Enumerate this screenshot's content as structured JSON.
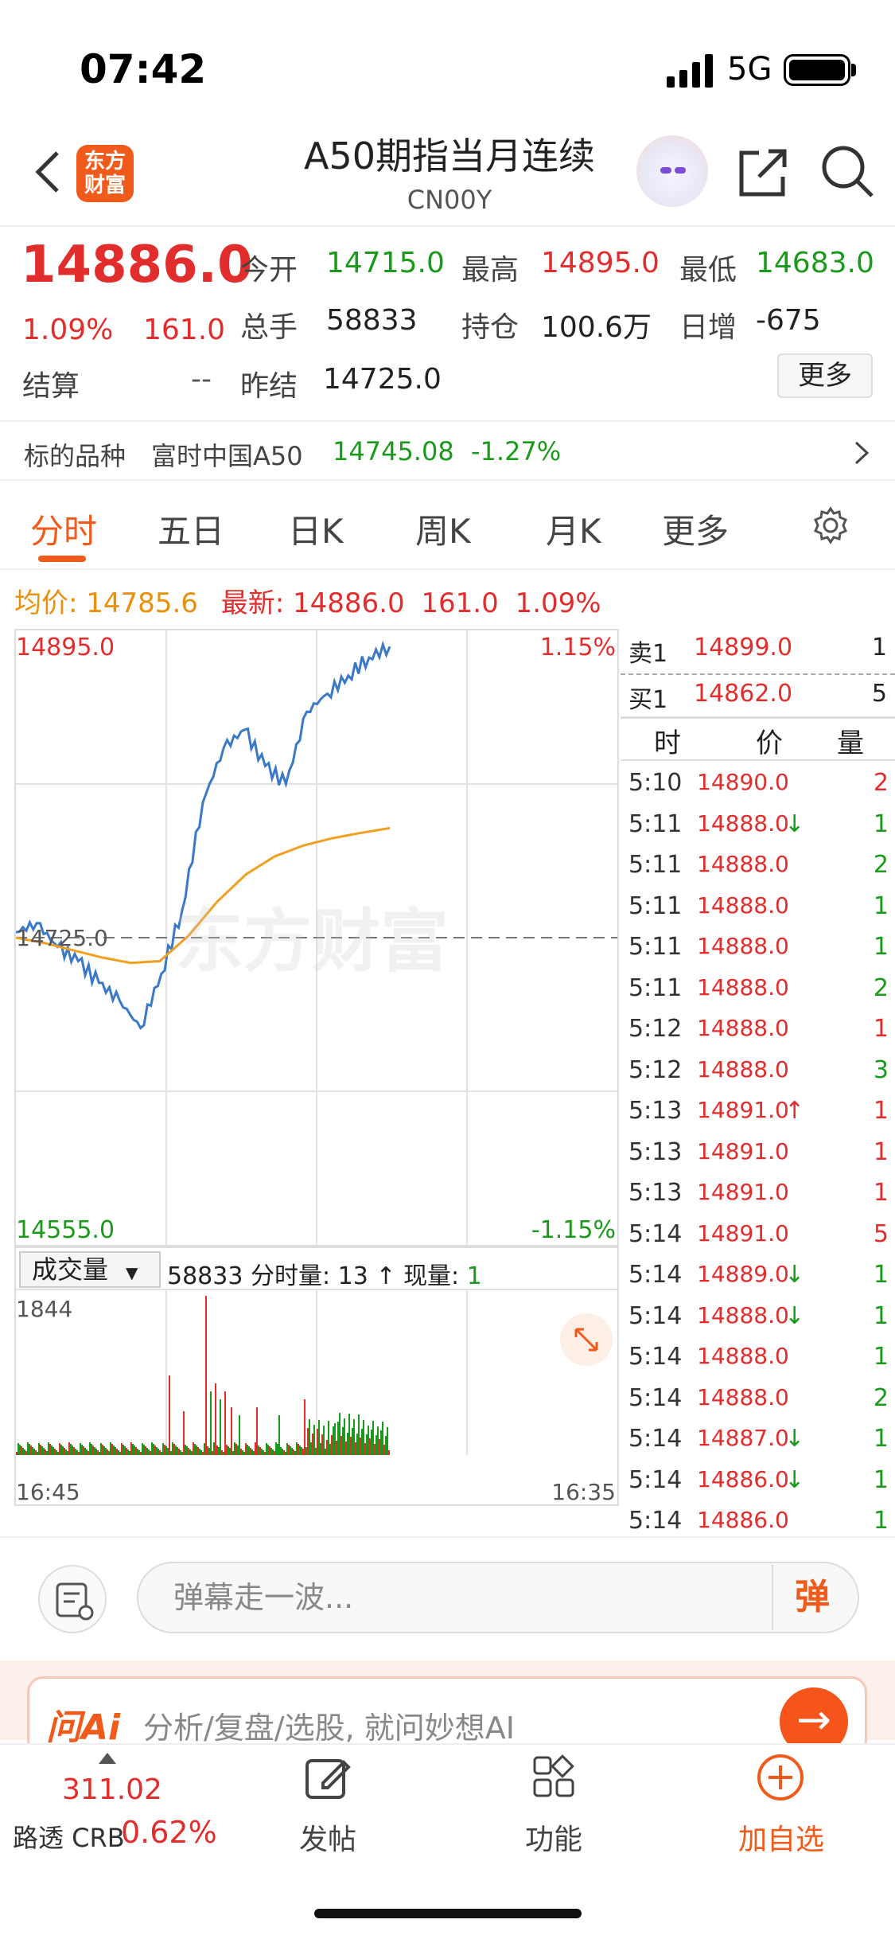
{
  "status": {
    "time": "07:42",
    "network": "5G"
  },
  "header": {
    "title": "A50期指当月连续",
    "code": "CN00Y",
    "logo": "东方财富"
  },
  "quote": {
    "last": "14886.0",
    "pct": "1.09%",
    "chg": "161.0",
    "rows": [
      [
        {
          "k": "今开",
          "v": "14715.0",
          "c": "green"
        },
        {
          "k": "最高",
          "v": "14895.0",
          "c": "red"
        },
        {
          "k": "最低",
          "v": "14683.0",
          "c": "green"
        }
      ],
      [
        {
          "k": "总手",
          "v": "58833",
          "c": "black"
        },
        {
          "k": "持仓",
          "v": "100.6万",
          "c": "black"
        },
        {
          "k": "日增",
          "v": "-675",
          "c": "black"
        }
      ]
    ],
    "settle_label": "结算",
    "settle": "--",
    "prev_label": "昨结",
    "prev": "14725.0",
    "more": "更多"
  },
  "underlying": {
    "label": "标的品种",
    "name": "富时中国A50",
    "value": "14745.08",
    "pct": "-1.27%"
  },
  "tabs": [
    "分时",
    "五日",
    "日K",
    "周K",
    "月K",
    "更多"
  ],
  "avgline": {
    "avg_label": "均价:",
    "avg": "14785.6",
    "last_label": "最新:",
    "last": "14886.0",
    "chg": "161.0",
    "pct": "1.09%"
  },
  "chart": {
    "ymax": "14895.0",
    "ymin": "14555.0",
    "mid": "14725.0",
    "pmax": "1.15%",
    "pmin": "-1.15%",
    "xstart": "16:45",
    "xend": "16:35",
    "watermark": "东方财富",
    "price_color": "#3a78c8",
    "avg_color": "#f0a020"
  },
  "volume": {
    "select": "成交量",
    "total": "58833",
    "fs_label": "分时量:",
    "fs": "13",
    "up": "↑",
    "now_label": "现量:",
    "now": "1",
    "max": "1844"
  },
  "chart_data": {
    "type": "line",
    "x": [
      "16:45",
      "16:35"
    ],
    "ylim": [
      14555.0,
      14895.0
    ],
    "prev_settle": 14725.0,
    "series": [
      {
        "values": [
          14728,
          14733,
          14720,
          14712,
          14700,
          14690,
          14675,
          14705,
          14740,
          14800,
          14830,
          14840,
          14820,
          14810,
          14850,
          14860,
          14870,
          14880,
          14886
        ]
      },
      {
        "values": [
          14725,
          14722,
          14718,
          14714,
          14711,
          14712,
          14726,
          14745,
          14760,
          14770,
          14776,
          14780,
          14783,
          14785.6
        ]
      }
    ]
  },
  "orderbook": {
    "sell": {
      "label": "卖1",
      "price": "14899.0",
      "qty": "1"
    },
    "buy": {
      "label": "买1",
      "price": "14862.0",
      "qty": "5"
    },
    "cols": [
      "时",
      "价",
      "量"
    ],
    "ticks": [
      [
        "5:10",
        "14890.0",
        "",
        "2",
        "red"
      ],
      [
        "5:11",
        "14888.0",
        "↓",
        "1",
        "green"
      ],
      [
        "5:11",
        "14888.0",
        "",
        "2",
        "green"
      ],
      [
        "5:11",
        "14888.0",
        "",
        "1",
        "green"
      ],
      [
        "5:11",
        "14888.0",
        "",
        "1",
        "green"
      ],
      [
        "5:11",
        "14888.0",
        "",
        "2",
        "green"
      ],
      [
        "5:12",
        "14888.0",
        "",
        "1",
        "red"
      ],
      [
        "5:12",
        "14888.0",
        "",
        "3",
        "green"
      ],
      [
        "5:13",
        "14891.0",
        "↑",
        "1",
        "red"
      ],
      [
        "5:13",
        "14891.0",
        "",
        "1",
        "red"
      ],
      [
        "5:13",
        "14891.0",
        "",
        "1",
        "red"
      ],
      [
        "5:14",
        "14891.0",
        "",
        "5",
        "red"
      ],
      [
        "5:14",
        "14889.0",
        "↓",
        "1",
        "green"
      ],
      [
        "5:14",
        "14888.0",
        "↓",
        "1",
        "green"
      ],
      [
        "5:14",
        "14888.0",
        "",
        "1",
        "green"
      ],
      [
        "5:14",
        "14888.0",
        "",
        "2",
        "green"
      ],
      [
        "5:14",
        "14887.0",
        "↓",
        "1",
        "green"
      ],
      [
        "5:14",
        "14886.0",
        "↓",
        "1",
        "green"
      ],
      [
        "5:14",
        "14886.0",
        "",
        "1",
        "green"
      ]
    ]
  },
  "input": {
    "placeholder": "弹幕走一波...",
    "danmu": "弹"
  },
  "ai": {
    "logo": "问Ai",
    "text": "分析/复盘/选股, 就问妙想AI",
    "go": "→"
  },
  "nav": {
    "crb_value": "311.02",
    "crb_label": "路透 CRB",
    "crb_pct": "0.62%",
    "items": [
      "发帖",
      "功能",
      "加自选"
    ]
  }
}
